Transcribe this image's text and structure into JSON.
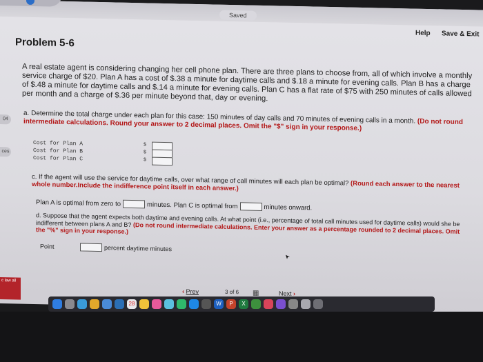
{
  "header": {
    "saved_status": "Saved",
    "help_label": "Help",
    "save_exit_label": "Save & Exit"
  },
  "problem": {
    "title": "Problem 5-6",
    "intro": "A real estate agent is considering changing her cell phone plan. There are three plans to choose from, all of which involve a monthly service charge of $20. Plan A has a cost of $.38 a minute for daytime calls and $.18 a minute for evening calls. Plan B has a charge of $.48 a minute for daytime calls and $.14 a minute for evening calls. Plan C has a flat rate of $75 with 250 minutes of calls allowed per month and a charge of $.36 per minute beyond that, day or evening."
  },
  "side_tabs": {
    "tab1": "04",
    "tab2": "ces"
  },
  "part_a": {
    "question": "a. Determine the total charge under each plan for this case: 150 minutes of day calls and 70 minutes of evening calls in a month.",
    "instruction": "(Do not round intermediate calculations. Round your answer to 2 decimal places. Omit the \"$\" sign in your response.)",
    "rows": [
      {
        "label": "Cost for Plan A",
        "currency": "$"
      },
      {
        "label": "Cost for Plan B",
        "currency": "$"
      },
      {
        "label": "Cost for Plan C",
        "currency": "$"
      }
    ]
  },
  "part_c": {
    "question": "c. If the agent will use the service for daytime calls, over what range of call minutes will each plan be optimal?",
    "instruction": "(Round each answer to the nearest whole number.Include the indifference point itself in each answer.)",
    "line_start": "Plan A is optimal from zero to",
    "line_middle": "minutes. Plan C is optimal from",
    "line_end": "minutes onward."
  },
  "part_d": {
    "question": "d. Suppose that the agent expects both daytime and evening calls. At what point (i.e., percentage of total call minutes used for daytime calls) would she be indifferent between plans A and B?",
    "instruction": "(Do not round intermediate calculations. Enter your answer as a percentage rounded to 2 decimal places. Omit the \"%\" sign in your response.)",
    "point_label": "Point",
    "point_suffix": "percent daytime minutes"
  },
  "nav": {
    "prev_label": "Prev",
    "page_info": "3 of 6",
    "next_label": "Next"
  },
  "left_logo": {
    "text": "c law all"
  },
  "dock": {
    "calendar_day": "28"
  }
}
